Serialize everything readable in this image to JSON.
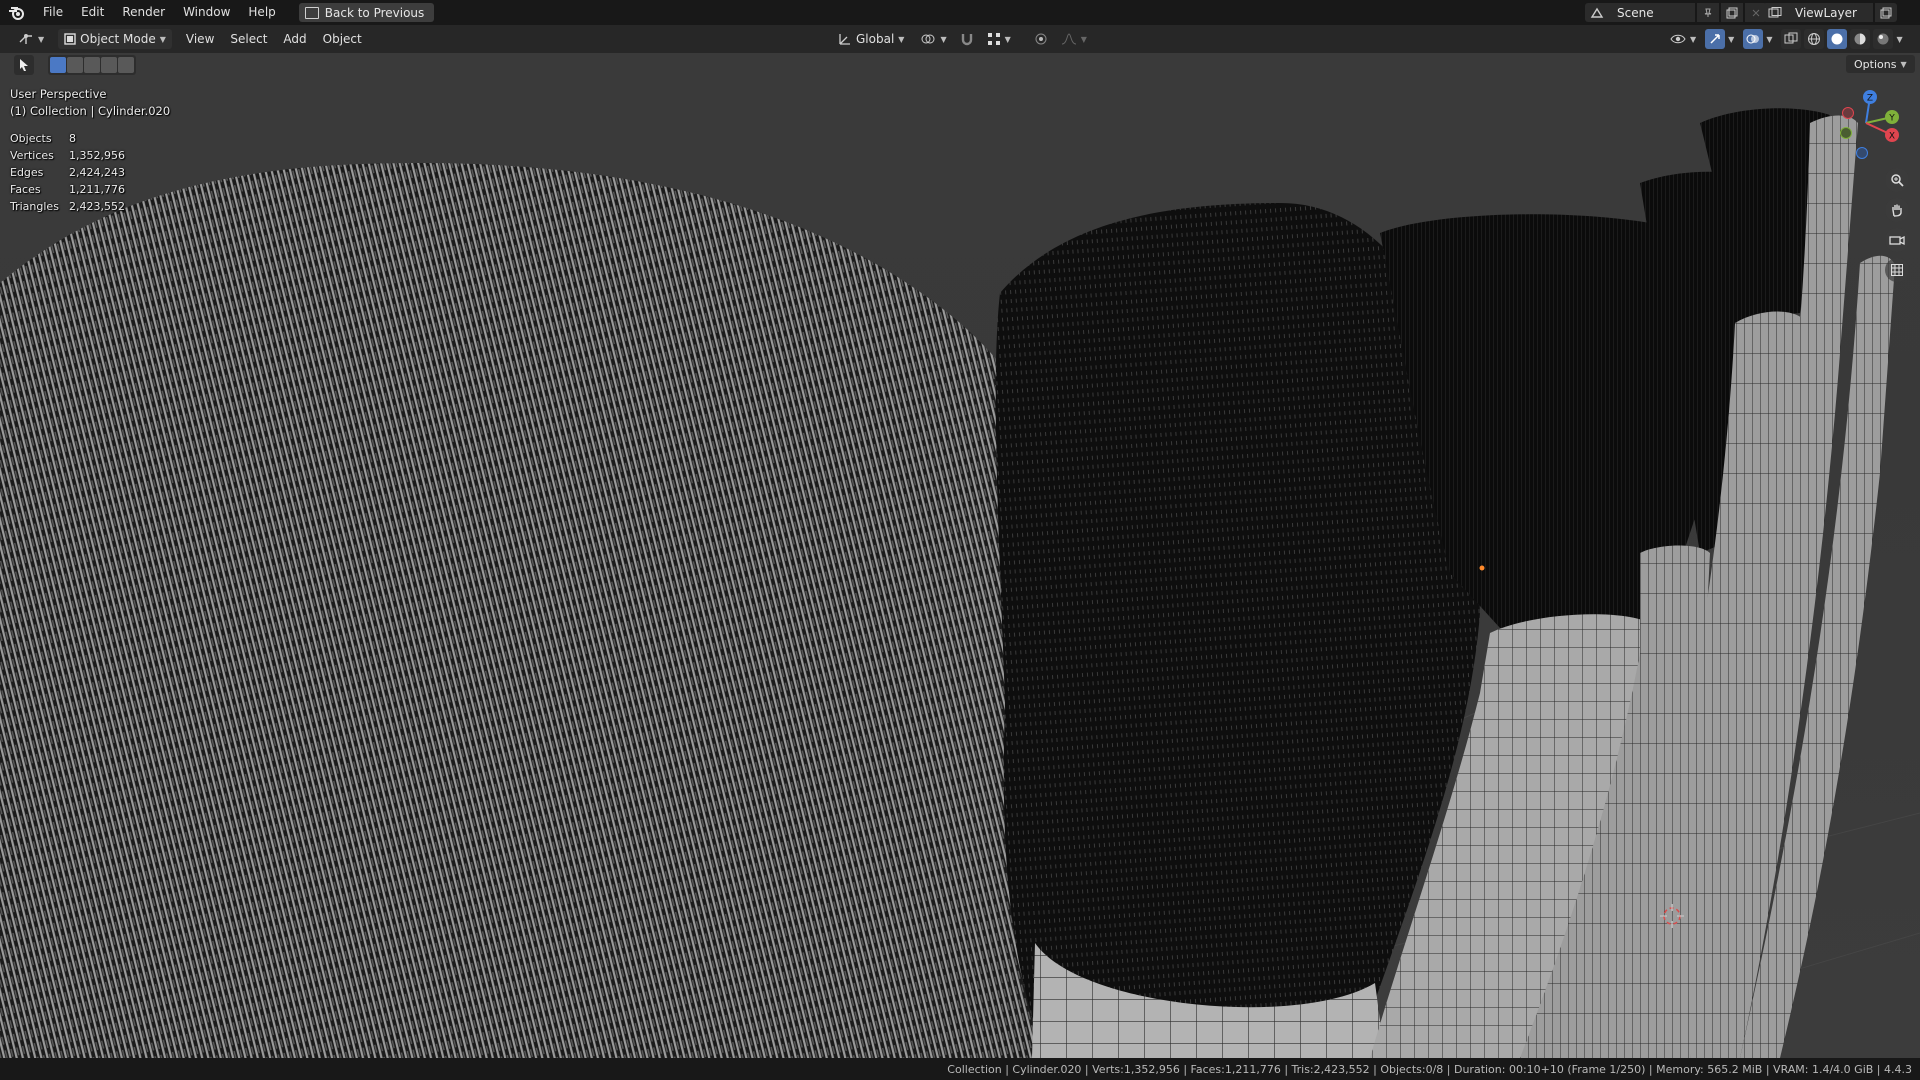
{
  "menubar": {
    "items": [
      "File",
      "Edit",
      "Render",
      "Window",
      "Help"
    ],
    "back_button": "Back to Previous",
    "scene_name": "Scene",
    "view_layer": "ViewLayer"
  },
  "header": {
    "mode": "Object Mode",
    "menus": [
      "View",
      "Select",
      "Add",
      "Object"
    ],
    "orientation": "Global",
    "options_label": "Options"
  },
  "viewport": {
    "perspective_label": "User Perspective",
    "active_object_label": "(1) Collection | Cylinder.020",
    "stats": [
      {
        "label": "Objects",
        "value": "8"
      },
      {
        "label": "Vertices",
        "value": "1,352,956"
      },
      {
        "label": "Edges",
        "value": "2,424,243"
      },
      {
        "label": "Faces",
        "value": "1,211,776"
      },
      {
        "label": "Triangles",
        "value": "2,423,552"
      }
    ],
    "gizmo_axes": [
      "Z",
      "Y",
      "X"
    ]
  },
  "statusbar": {
    "text": "Collection | Cylinder.020 | Verts:1,352,956 | Faces:1,211,776 | Tris:2,423,552 | Objects:0/8 | Duration: 00:10+10 (Frame 1/250) | Memory: 565.2 MiB | VRAM: 1.4/4.0 GiB | 4.4.3"
  },
  "colors": {
    "accent": "#4b79c5",
    "x_axis": "#e0454f",
    "y_axis": "#7fb03a",
    "z_axis": "#3f7fe0"
  }
}
